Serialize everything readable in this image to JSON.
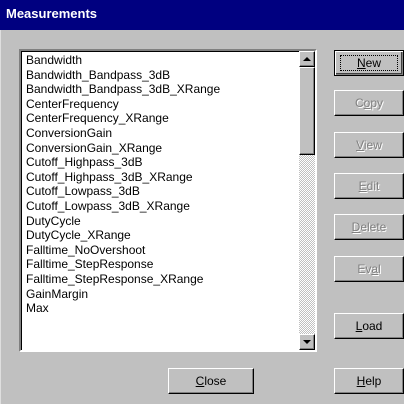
{
  "window": {
    "title": "Measurements"
  },
  "measurements": {
    "items": [
      "Bandwidth",
      "Bandwidth_Bandpass_3dB",
      "Bandwidth_Bandpass_3dB_XRange",
      "CenterFrequency",
      "CenterFrequency_XRange",
      "ConversionGain",
      "ConversionGain_XRange",
      "Cutoff_Highpass_3dB",
      "Cutoff_Highpass_3dB_XRange",
      "Cutoff_Lowpass_3dB",
      "Cutoff_Lowpass_3dB_XRange",
      "DutyCycle",
      "DutyCycle_XRange",
      "Falltime_NoOvershoot",
      "Falltime_StepResponse",
      "Falltime_StepResponse_XRange",
      "GainMargin",
      "Max"
    ]
  },
  "buttons": {
    "new": {
      "mnemonic": "N",
      "rest": "ew"
    },
    "copy": {
      "before": "C",
      "mnemonic": "o",
      "rest": "py"
    },
    "view": {
      "mnemonic": "V",
      "rest": "iew"
    },
    "edit": {
      "mnemonic": "E",
      "rest": "dit"
    },
    "delete": {
      "mnemonic": "D",
      "rest": "elete"
    },
    "eval": {
      "before": "Ev",
      "mnemonic": "a",
      "rest": "l"
    },
    "load": {
      "mnemonic": "L",
      "rest": "oad"
    },
    "close": {
      "mnemonic": "C",
      "rest": "lose"
    },
    "help": {
      "mnemonic": "H",
      "rest": "elp"
    }
  }
}
